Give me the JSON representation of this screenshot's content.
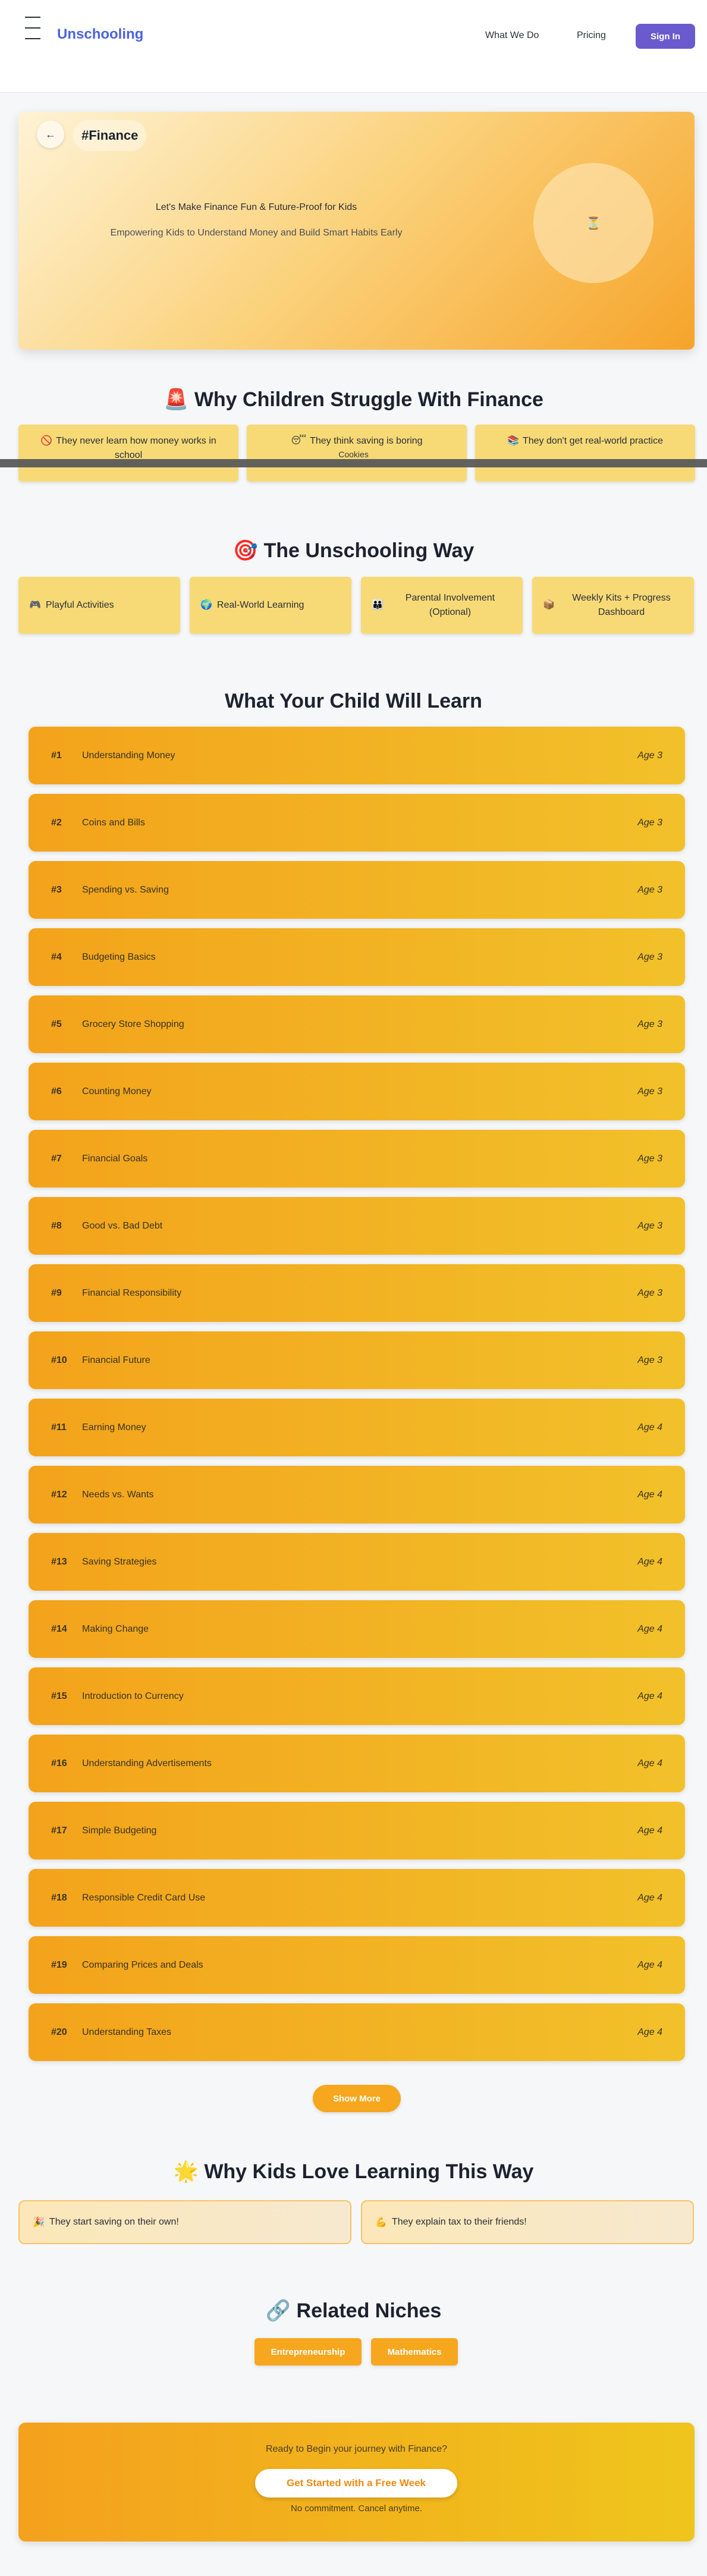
{
  "nav": {
    "brand": "Unschooling",
    "links": [
      "What We Do",
      "Pricing"
    ],
    "signin": "Sign In"
  },
  "hero": {
    "back_icon": "arrow-left-icon",
    "tag": "#Finance",
    "title": "Let's Make Finance Fun & Future-Proof for Kids",
    "subtitle": "Empowering Kids to Understand Money and Build Smart Habits Early",
    "circle_icon": "hourglass-icon"
  },
  "struggle": {
    "heading_icon": "🚨",
    "heading": "Why Children Struggle With Finance",
    "cards": [
      {
        "icon": "🚫",
        "text": "They never learn how money works in school"
      },
      {
        "icon": "😴",
        "text": "They think saving is boring"
      },
      {
        "icon": "📚",
        "text": "They don't get real-world practice"
      }
    ],
    "overlay_text": "Cookies"
  },
  "way": {
    "heading_icon": "🎯",
    "heading": "The Unschooling Way",
    "cards": [
      {
        "icon": "🎮",
        "text": "Playful Activities"
      },
      {
        "icon": "🌍",
        "text": "Real-World Learning"
      },
      {
        "icon": "👪",
        "text": "Parental Involvement (Optional)"
      },
      {
        "icon": "📦",
        "text": "Weekly Kits + Progress Dashboard"
      }
    ]
  },
  "learn": {
    "heading": "What Your Child Will Learn",
    "items": [
      {
        "num": "#1",
        "title": "Understanding Money",
        "age": "Age 3"
      },
      {
        "num": "#2",
        "title": "Coins and Bills",
        "age": "Age 3"
      },
      {
        "num": "#3",
        "title": "Spending vs. Saving",
        "age": "Age 3"
      },
      {
        "num": "#4",
        "title": "Budgeting Basics",
        "age": "Age 3"
      },
      {
        "num": "#5",
        "title": "Grocery Store Shopping",
        "age": "Age 3"
      },
      {
        "num": "#6",
        "title": "Counting Money",
        "age": "Age 3"
      },
      {
        "num": "#7",
        "title": "Financial Goals",
        "age": "Age 3"
      },
      {
        "num": "#8",
        "title": "Good vs. Bad Debt",
        "age": "Age 3"
      },
      {
        "num": "#9",
        "title": "Financial Responsibility",
        "age": "Age 3"
      },
      {
        "num": "#10",
        "title": "Financial Future",
        "age": "Age 3"
      },
      {
        "num": "#11",
        "title": "Earning Money",
        "age": "Age 4"
      },
      {
        "num": "#12",
        "title": "Needs vs. Wants",
        "age": "Age 4"
      },
      {
        "num": "#13",
        "title": "Saving Strategies",
        "age": "Age 4"
      },
      {
        "num": "#14",
        "title": "Making Change",
        "age": "Age 4"
      },
      {
        "num": "#15",
        "title": "Introduction to Currency",
        "age": "Age 4"
      },
      {
        "num": "#16",
        "title": "Understanding Advertisements",
        "age": "Age 4"
      },
      {
        "num": "#17",
        "title": "Simple Budgeting",
        "age": "Age 4"
      },
      {
        "num": "#18",
        "title": "Responsible Credit Card Use",
        "age": "Age 4"
      },
      {
        "num": "#19",
        "title": "Comparing Prices and Deals",
        "age": "Age 4"
      },
      {
        "num": "#20",
        "title": "Understanding Taxes",
        "age": "Age 4"
      }
    ],
    "show_more": "Show More"
  },
  "love": {
    "heading_icon": "🌟",
    "heading": "Why Kids Love Learning This Way",
    "cards": [
      {
        "icon": "🎉",
        "text": "They start saving on their own!"
      },
      {
        "icon": "💪",
        "text": "They explain tax to their friends!"
      }
    ]
  },
  "related": {
    "heading_icon": "🔗",
    "heading": "Related Niches",
    "niches": [
      "Entrepreneurship",
      "Mathematics"
    ]
  },
  "cta": {
    "title": "Ready to Begin your journey with Finance?",
    "button": "Get Started with a Free Week",
    "note": "No commitment. Cancel anytime."
  },
  "colors": {
    "brand": "#4a63e0",
    "signin_bg": "#6a5acd",
    "accent_orange": "#f6a71d",
    "card_yellow": "#f7da76"
  }
}
